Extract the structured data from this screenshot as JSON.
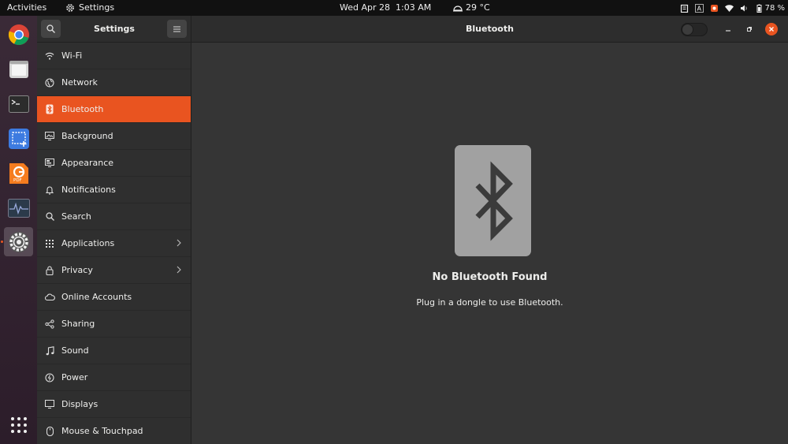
{
  "topbar": {
    "activities": "Activities",
    "app_name": "Settings",
    "clock": "Wed Apr 28  1:03 AM",
    "weather": "29 °C",
    "battery": "78 %"
  },
  "dock": {
    "items": [
      "chrome-icon",
      "files-icon",
      "terminal-icon",
      "screenshot-icon",
      "pdf-editor-icon",
      "system-monitor-icon",
      "settings-icon"
    ],
    "show_apps": "app-grid-icon"
  },
  "window": {
    "sidebar_title": "Settings",
    "page_title": "Bluetooth"
  },
  "sidebar": {
    "items": [
      {
        "label": "Wi-Fi",
        "icon": "wifi-icon"
      },
      {
        "label": "Network",
        "icon": "network-icon"
      },
      {
        "label": "Bluetooth",
        "icon": "bluetooth-icon"
      },
      {
        "label": "Background",
        "icon": "background-icon"
      },
      {
        "label": "Appearance",
        "icon": "appearance-icon"
      },
      {
        "label": "Notifications",
        "icon": "bell-icon"
      },
      {
        "label": "Search",
        "icon": "search-icon"
      },
      {
        "label": "Applications",
        "icon": "grid-icon"
      },
      {
        "label": "Privacy",
        "icon": "lock-icon"
      },
      {
        "label": "Online Accounts",
        "icon": "cloud-icon"
      },
      {
        "label": "Sharing",
        "icon": "share-icon"
      },
      {
        "label": "Sound",
        "icon": "music-icon"
      },
      {
        "label": "Power",
        "icon": "power-icon"
      },
      {
        "label": "Displays",
        "icon": "display-icon"
      },
      {
        "label": "Mouse & Touchpad",
        "icon": "mouse-icon"
      }
    ]
  },
  "content": {
    "title": "No Bluetooth Found",
    "subtitle": "Plug in a dongle to use Bluetooth."
  },
  "colors": {
    "accent": "#e95420",
    "panel": "#353535",
    "sidebar": "#2f2f2f"
  }
}
